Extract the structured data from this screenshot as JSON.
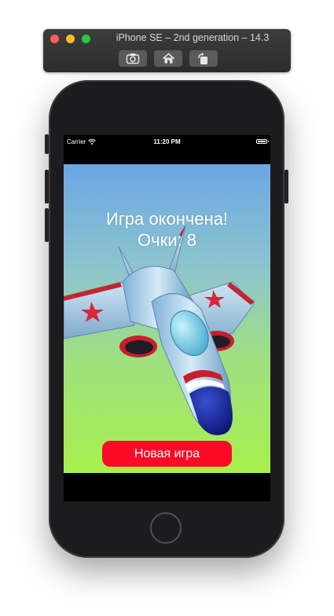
{
  "simulator": {
    "title": "iPhone SE – 2nd generation – 14.3",
    "toolbar": {
      "screenshot_icon": "camera-icon",
      "home_icon": "home-icon",
      "rotate_icon": "rotate-icon"
    }
  },
  "status_bar": {
    "carrier": "Carrier",
    "time": "11:20 PM",
    "wifi_icon": "wifi-icon",
    "battery_icon": "battery-icon"
  },
  "game": {
    "title": "Игра окончена!",
    "score": "Очки: 8",
    "new_game_label": "Новая игра",
    "plane_image": "fighter-jet",
    "colors": {
      "button": "#fd0a26",
      "sky_top": "#6ca6e4",
      "ground": "#a8f04c"
    }
  }
}
